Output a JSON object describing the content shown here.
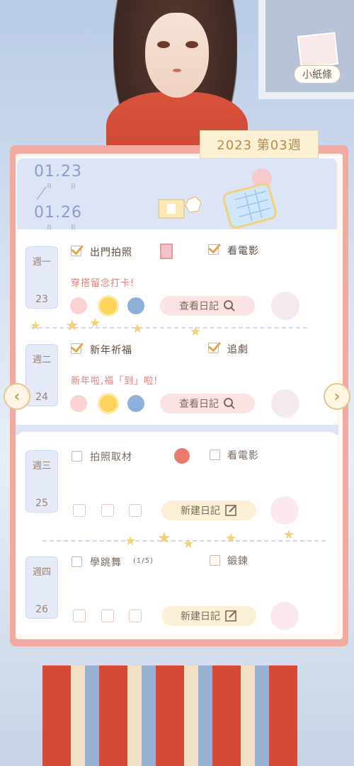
{
  "top_right": {
    "note_label": "小紙條"
  },
  "week_tag": "2023 第03週",
  "date_range": {
    "start": "01.23",
    "end": "01.26",
    "month_label": "月",
    "day_label": "日"
  },
  "days": [
    {
      "weekday": "週一",
      "date": "23",
      "tasks": [
        {
          "label": "出門拍照",
          "checked": true
        },
        {
          "label": "看電影",
          "checked": true
        }
      ],
      "diary": "穿搭留念打卡!",
      "moods": [
        "face-icon",
        "sun-icon",
        "snow-globe-icon"
      ],
      "action": "查看日記"
    },
    {
      "weekday": "週二",
      "date": "24",
      "tasks": [
        {
          "label": "新年祈福",
          "checked": true
        },
        {
          "label": "追劇",
          "checked": true
        }
      ],
      "diary": "新年啦,福「到」啦!",
      "moods": [
        "face-icon",
        "sun-icon",
        "snow-globe-icon"
      ],
      "action": "查看日記"
    },
    {
      "weekday": "週三",
      "date": "25",
      "tasks": [
        {
          "label": "拍照取材",
          "checked": false
        },
        {
          "label": "看電影",
          "checked": false
        }
      ],
      "action": "新建日記"
    },
    {
      "weekday": "週四",
      "date": "26",
      "tasks": [
        {
          "label": "學跳舞",
          "checked": false
        },
        {
          "label": "鍛鍊",
          "checked": false
        }
      ],
      "task_progress": "(1/5)",
      "action": "新建日記"
    }
  ],
  "colors": {
    "accent": "#e0a64f",
    "planner_border": "#f1a9a0",
    "header_bg": "#dde4f6",
    "text_pink": "#e07d78"
  }
}
